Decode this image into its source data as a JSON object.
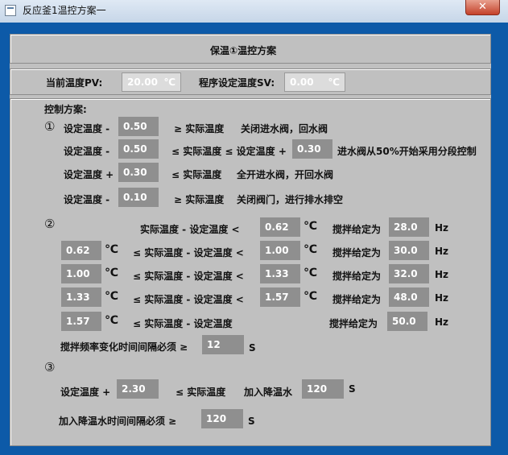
{
  "window": {
    "title": "反应釜1温控方案一",
    "close_label": "✕"
  },
  "header": {
    "title": "保温①温控方案"
  },
  "status": {
    "pv_label": "当前温度PV:",
    "pv_value": "20.00",
    "pv_unit": "℃",
    "sv_label": "程序设定温度SV:",
    "sv_value": "0.00",
    "sv_unit": "℃"
  },
  "control": {
    "title": "控制方案:",
    "s1": {
      "marker": "①",
      "r1": {
        "a": "设定温度 -",
        "v": "0.50",
        "b": "≥ 实际温度",
        "c": "关闭进水阀，回水阀"
      },
      "r2": {
        "a": "设定温度 -",
        "v": "0.50",
        "b": "≤ 实际温度 ≤ 设定温度 +",
        "v2": "0.30",
        "c": "进水阀从50%开始采用分段控制"
      },
      "r3": {
        "a": "设定温度 +",
        "v": "0.30",
        "b": "≤ 实际温度",
        "c": "全开进水阀，开回水阀"
      },
      "r4": {
        "a": "设定温度 -",
        "v": "0.10",
        "b": "≥ 实际温度",
        "c": "关闭阀门，进行排水排空"
      }
    },
    "s2": {
      "marker": "②",
      "unit_c": "℃",
      "unit_hz": "Hz",
      "stir_label": "搅拌给定为",
      "r1": {
        "mid": "实际温度 - 设定温度 <",
        "hi": "0.62",
        "hz": "28.0"
      },
      "r2": {
        "lo": "0.62",
        "mid": "≤ 实际温度 - 设定温度 <",
        "hi": "1.00",
        "hz": "30.0"
      },
      "r3": {
        "lo": "1.00",
        "mid": "≤ 实际温度 - 设定温度 <",
        "hi": "1.33",
        "hz": "32.0"
      },
      "r4": {
        "lo": "1.33",
        "mid": "≤ 实际温度 - 设定温度 <",
        "hi": "1.57",
        "hz": "48.0"
      },
      "r5": {
        "lo": "1.57",
        "mid": "≤ 实际温度 - 设定温度",
        "hz": "50.0"
      },
      "interval_label": "搅拌频率变化时间间隔必须 ≥",
      "interval_value": "12",
      "interval_unit": "S"
    },
    "s3": {
      "marker": "③",
      "a": "设定温度 +",
      "v": "2.30",
      "b": "≤ 实际温度",
      "c": "加入降温水",
      "v2": "120",
      "unit": "S",
      "interval_label": "加入降温水时间间隔必须 ≥",
      "interval_value": "120",
      "interval_unit": "S"
    }
  }
}
